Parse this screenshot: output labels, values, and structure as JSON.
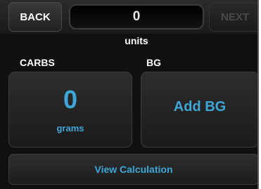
{
  "header": {
    "back_label": "BACK",
    "next_label": "NEXT",
    "units_value": "0",
    "units_label": "units"
  },
  "carbs": {
    "section_label": "CARBS",
    "value": "0",
    "unit": "grams"
  },
  "bg": {
    "section_label": "BG",
    "add_label": "Add BG"
  },
  "footer": {
    "calc_label": "View Calculation"
  },
  "colors": {
    "accent": "#3fa6d8",
    "background": "#101010",
    "disabled_text": "#4a4a4a"
  }
}
